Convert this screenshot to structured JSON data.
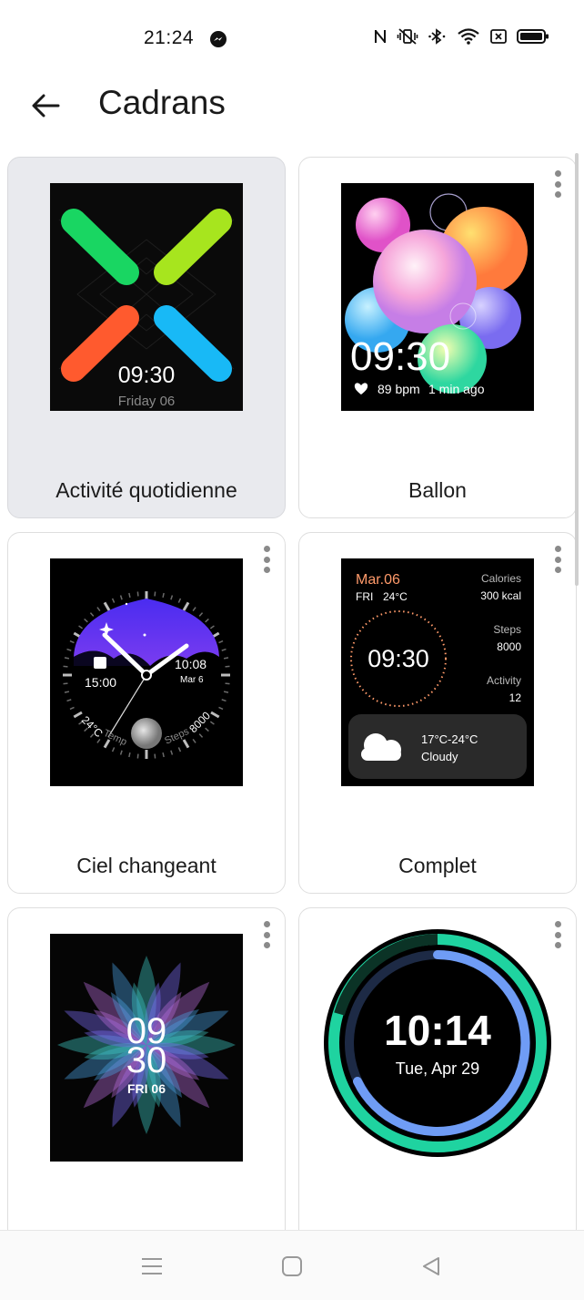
{
  "status_bar": {
    "time": "21:24",
    "icons": [
      "messenger-icon",
      "nfc-icon",
      "vibrate-icon",
      "bluetooth-icon",
      "wifi-icon",
      "sim-icon",
      "battery-icon"
    ]
  },
  "header": {
    "title": "Cadrans",
    "back_icon": "back-arrow-icon"
  },
  "watch_faces": [
    {
      "name": "Activité quotidienne",
      "selected": true,
      "preview": {
        "time": "09:30",
        "date": "Friday 06"
      }
    },
    {
      "name": "Ballon",
      "selected": false,
      "preview": {
        "time": "09:30",
        "heart": "89 bpm",
        "ago": "1 min ago"
      }
    },
    {
      "name": "Ciel changeant",
      "selected": false,
      "preview": {
        "time_left": "15:00",
        "time_right": "10:08",
        "date_right": "Mar 6",
        "temp": "24°C",
        "temp_label": "Temp",
        "steps_label": "Steps",
        "steps": "8000"
      }
    },
    {
      "name": "Complet",
      "selected": false,
      "preview": {
        "date": "Mar.06",
        "day": "FRI",
        "temp": "24°C",
        "calories_label": "Calories",
        "calories": "300 kcal",
        "steps_label": "Steps",
        "steps": "8000",
        "activity_label": "Activity",
        "activity": "12",
        "time": "09:30",
        "weather_range": "17°C-24°C",
        "weather": "Cloudy"
      }
    },
    {
      "name": "",
      "selected": false,
      "preview": {
        "hour": "09",
        "minute": "30",
        "date": "FRI 06"
      }
    },
    {
      "name": "",
      "selected": false,
      "preview": {
        "time": "10:14",
        "date": "Tue, Apr 29"
      }
    }
  ],
  "nav_bar": {
    "icons": [
      "menu-icon",
      "home-icon",
      "back-triangle-icon"
    ]
  },
  "colors": {
    "selected_card_bg": "#e9eaee",
    "accent_green": "#1fd3a0",
    "accent_blue": "#6f9cf5",
    "complet_orange": "#ff9a6a"
  }
}
